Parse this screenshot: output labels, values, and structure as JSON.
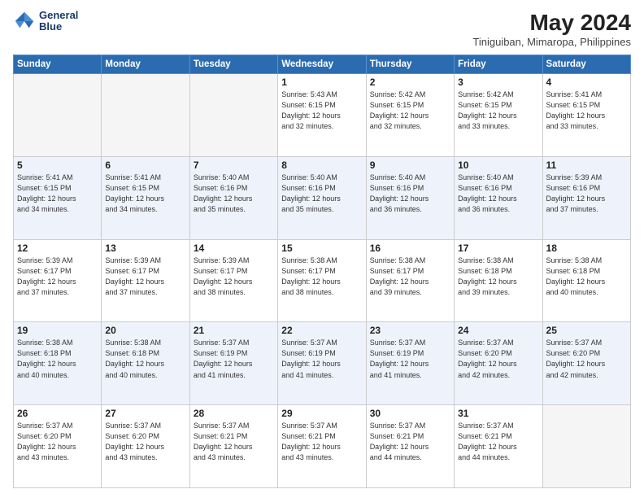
{
  "header": {
    "logo_line1": "General",
    "logo_line2": "Blue",
    "title": "May 2024",
    "subtitle": "Tiniguiban, Mimaropa, Philippines"
  },
  "days_of_week": [
    "Sunday",
    "Monday",
    "Tuesday",
    "Wednesday",
    "Thursday",
    "Friday",
    "Saturday"
  ],
  "weeks": [
    [
      {
        "day": "",
        "info": ""
      },
      {
        "day": "",
        "info": ""
      },
      {
        "day": "",
        "info": ""
      },
      {
        "day": "1",
        "info": "Sunrise: 5:43 AM\nSunset: 6:15 PM\nDaylight: 12 hours\nand 32 minutes."
      },
      {
        "day": "2",
        "info": "Sunrise: 5:42 AM\nSunset: 6:15 PM\nDaylight: 12 hours\nand 32 minutes."
      },
      {
        "day": "3",
        "info": "Sunrise: 5:42 AM\nSunset: 6:15 PM\nDaylight: 12 hours\nand 33 minutes."
      },
      {
        "day": "4",
        "info": "Sunrise: 5:41 AM\nSunset: 6:15 PM\nDaylight: 12 hours\nand 33 minutes."
      }
    ],
    [
      {
        "day": "5",
        "info": "Sunrise: 5:41 AM\nSunset: 6:15 PM\nDaylight: 12 hours\nand 34 minutes."
      },
      {
        "day": "6",
        "info": "Sunrise: 5:41 AM\nSunset: 6:15 PM\nDaylight: 12 hours\nand 34 minutes."
      },
      {
        "day": "7",
        "info": "Sunrise: 5:40 AM\nSunset: 6:16 PM\nDaylight: 12 hours\nand 35 minutes."
      },
      {
        "day": "8",
        "info": "Sunrise: 5:40 AM\nSunset: 6:16 PM\nDaylight: 12 hours\nand 35 minutes."
      },
      {
        "day": "9",
        "info": "Sunrise: 5:40 AM\nSunset: 6:16 PM\nDaylight: 12 hours\nand 36 minutes."
      },
      {
        "day": "10",
        "info": "Sunrise: 5:40 AM\nSunset: 6:16 PM\nDaylight: 12 hours\nand 36 minutes."
      },
      {
        "day": "11",
        "info": "Sunrise: 5:39 AM\nSunset: 6:16 PM\nDaylight: 12 hours\nand 37 minutes."
      }
    ],
    [
      {
        "day": "12",
        "info": "Sunrise: 5:39 AM\nSunset: 6:17 PM\nDaylight: 12 hours\nand 37 minutes."
      },
      {
        "day": "13",
        "info": "Sunrise: 5:39 AM\nSunset: 6:17 PM\nDaylight: 12 hours\nand 37 minutes."
      },
      {
        "day": "14",
        "info": "Sunrise: 5:39 AM\nSunset: 6:17 PM\nDaylight: 12 hours\nand 38 minutes."
      },
      {
        "day": "15",
        "info": "Sunrise: 5:38 AM\nSunset: 6:17 PM\nDaylight: 12 hours\nand 38 minutes."
      },
      {
        "day": "16",
        "info": "Sunrise: 5:38 AM\nSunset: 6:17 PM\nDaylight: 12 hours\nand 39 minutes."
      },
      {
        "day": "17",
        "info": "Sunrise: 5:38 AM\nSunset: 6:18 PM\nDaylight: 12 hours\nand 39 minutes."
      },
      {
        "day": "18",
        "info": "Sunrise: 5:38 AM\nSunset: 6:18 PM\nDaylight: 12 hours\nand 40 minutes."
      }
    ],
    [
      {
        "day": "19",
        "info": "Sunrise: 5:38 AM\nSunset: 6:18 PM\nDaylight: 12 hours\nand 40 minutes."
      },
      {
        "day": "20",
        "info": "Sunrise: 5:38 AM\nSunset: 6:18 PM\nDaylight: 12 hours\nand 40 minutes."
      },
      {
        "day": "21",
        "info": "Sunrise: 5:37 AM\nSunset: 6:19 PM\nDaylight: 12 hours\nand 41 minutes."
      },
      {
        "day": "22",
        "info": "Sunrise: 5:37 AM\nSunset: 6:19 PM\nDaylight: 12 hours\nand 41 minutes."
      },
      {
        "day": "23",
        "info": "Sunrise: 5:37 AM\nSunset: 6:19 PM\nDaylight: 12 hours\nand 41 minutes."
      },
      {
        "day": "24",
        "info": "Sunrise: 5:37 AM\nSunset: 6:20 PM\nDaylight: 12 hours\nand 42 minutes."
      },
      {
        "day": "25",
        "info": "Sunrise: 5:37 AM\nSunset: 6:20 PM\nDaylight: 12 hours\nand 42 minutes."
      }
    ],
    [
      {
        "day": "26",
        "info": "Sunrise: 5:37 AM\nSunset: 6:20 PM\nDaylight: 12 hours\nand 43 minutes."
      },
      {
        "day": "27",
        "info": "Sunrise: 5:37 AM\nSunset: 6:20 PM\nDaylight: 12 hours\nand 43 minutes."
      },
      {
        "day": "28",
        "info": "Sunrise: 5:37 AM\nSunset: 6:21 PM\nDaylight: 12 hours\nand 43 minutes."
      },
      {
        "day": "29",
        "info": "Sunrise: 5:37 AM\nSunset: 6:21 PM\nDaylight: 12 hours\nand 43 minutes."
      },
      {
        "day": "30",
        "info": "Sunrise: 5:37 AM\nSunset: 6:21 PM\nDaylight: 12 hours\nand 44 minutes."
      },
      {
        "day": "31",
        "info": "Sunrise: 5:37 AM\nSunset: 6:21 PM\nDaylight: 12 hours\nand 44 minutes."
      },
      {
        "day": "",
        "info": ""
      }
    ]
  ]
}
